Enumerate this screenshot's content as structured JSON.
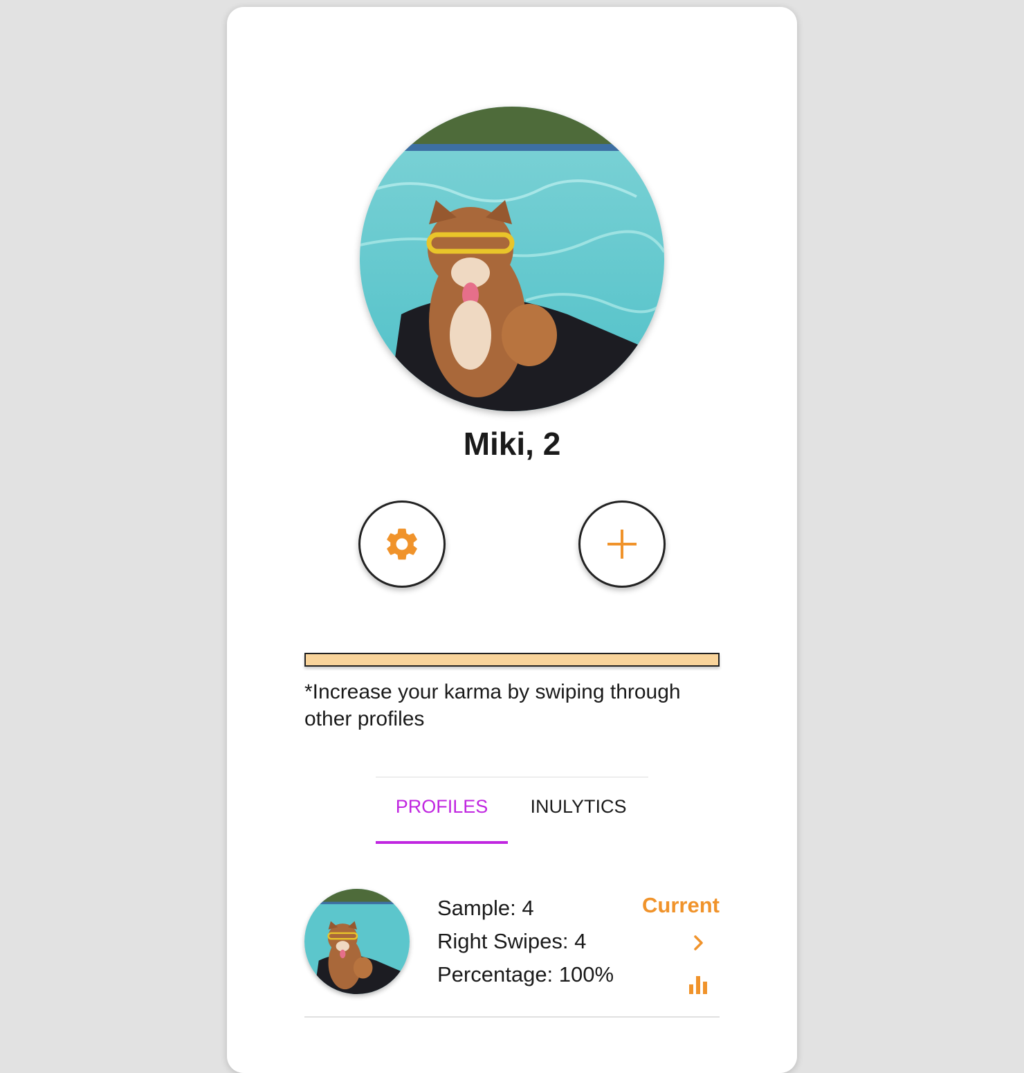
{
  "profile": {
    "name": "Miki, 2",
    "photo_alt": "Miki photo"
  },
  "actions": {
    "settings_icon": "gear-icon",
    "add_icon": "plus-icon"
  },
  "karma": {
    "level": 1.0,
    "note": "*Increase your karma by swiping through other profiles"
  },
  "tabs": [
    {
      "label": "PROFILES",
      "active": true
    },
    {
      "label": "INULYTICS",
      "active": false
    }
  ],
  "profiles_list": [
    {
      "sample": "Sample: 4",
      "right_swipes": "Right Swipes: 4",
      "percentage": "Percentage: 100%",
      "status": "Current"
    }
  ],
  "colors": {
    "accent_orange": "#f0932b",
    "tab_active": "#c026e0",
    "karma_fill": "#f9d49b"
  }
}
